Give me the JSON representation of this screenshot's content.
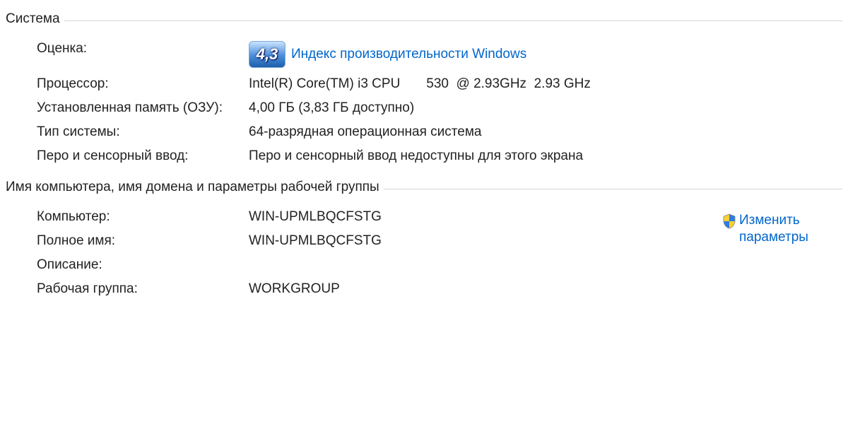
{
  "colors": {
    "link": "#0066cc",
    "divider": "#d6d6d6"
  },
  "system": {
    "legend": "Система",
    "rating": {
      "label": "Оценка:",
      "score": "4,3",
      "link": "Индекс производительности Windows"
    },
    "processor": {
      "label": "Процессор:",
      "value": "Intel(R) Core(TM) i3 CPU       530  @ 2.93GHz  2.93 GHz"
    },
    "ram": {
      "label": "Установленная память (ОЗУ):",
      "value": "4,00 ГБ (3,83 ГБ доступно)"
    },
    "system_type": {
      "label": "Тип системы:",
      "value": "64-разрядная операционная система"
    },
    "pen_touch": {
      "label": "Перо и сенсорный ввод:",
      "value": "Перо и сенсорный ввод недоступны для этого экрана"
    }
  },
  "computer": {
    "legend": "Имя компьютера, имя домена и параметры рабочей группы",
    "action": "Изменить параметры",
    "name": {
      "label": "Компьютер:",
      "value": "WIN-UPMLBQCFSTG"
    },
    "full_name": {
      "label": "Полное имя:",
      "value": "WIN-UPMLBQCFSTG"
    },
    "description": {
      "label": "Описание:",
      "value": ""
    },
    "workgroup": {
      "label": "Рабочая группа:",
      "value": "WORKGROUP"
    }
  }
}
